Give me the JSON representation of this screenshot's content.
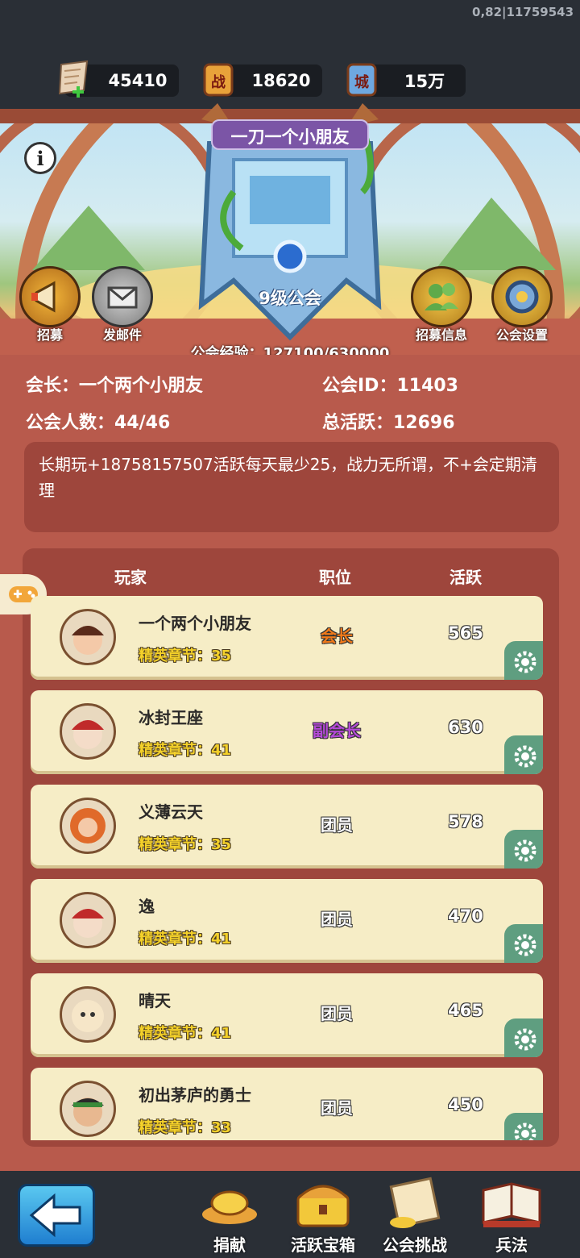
{
  "debug_text": "0,82|11759543",
  "resources": [
    {
      "icon": "scroll-hand-icon",
      "value": "45410"
    },
    {
      "icon": "battle-seal-icon",
      "value": "18620",
      "glyph": "战"
    },
    {
      "icon": "city-seal-icon",
      "value": "15万",
      "glyph": "城"
    }
  ],
  "guild": {
    "name": "一刀一个小朋友",
    "level_label": "9级公会",
    "exp_label": "公会经验：127100/630000",
    "leader": "会长：一个两个小朋友",
    "id_label": "公会ID：11403",
    "members_label": "公会人数：44/46",
    "total_activity": "总活跃：12696",
    "motto": "长期玩+18758157507活跃每天最少25，战力无所谓，不+会定期清理"
  },
  "side_buttons": {
    "recruit": "招募",
    "send_mail": "发邮件",
    "recruit_info": "招募信息",
    "guild_settings": "公会设置"
  },
  "table": {
    "headers": [
      "玩家",
      "职位",
      "活跃"
    ],
    "rows": [
      {
        "name": "一个两个小朋友",
        "chapter": "精英章节：35",
        "role": "会长",
        "role_color": "#f07a1a",
        "activity": "565"
      },
      {
        "name": "冰封王座",
        "chapter": "精英章节：41",
        "role": "副会长",
        "role_color": "#b54ad8",
        "activity": "630"
      },
      {
        "name": "义薄云天",
        "chapter": "精英章节：35",
        "role": "团员",
        "role_color": "#ffffff",
        "activity": "578"
      },
      {
        "name": "逸",
        "chapter": "精英章节：41",
        "role": "团员",
        "role_color": "#ffffff",
        "activity": "470"
      },
      {
        "name": "晴天",
        "chapter": "精英章节：41",
        "role": "团员",
        "role_color": "#ffffff",
        "activity": "465"
      },
      {
        "name": "初出茅庐的勇士",
        "chapter": "精英章节：33",
        "role": "团员",
        "role_color": "#ffffff",
        "activity": "450"
      }
    ]
  },
  "bottom_nav": {
    "donate": "捐献",
    "activity_chest": "活跃宝箱",
    "guild_challenge": "公会挑战",
    "tactics": "兵法"
  }
}
